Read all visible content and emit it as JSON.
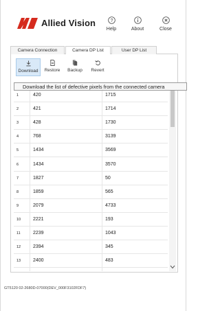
{
  "header": {
    "brand": "Allied Vision",
    "brand_color": "#d52b1e",
    "help_label": "Help",
    "about_label": "About",
    "close_label": "Close"
  },
  "tabs": [
    {
      "label": "Camera Connection"
    },
    {
      "label": "Camera DP List"
    },
    {
      "label": "User DP List"
    }
  ],
  "toolbar": {
    "download_label": "Download",
    "restore_label": "Restore",
    "backup_label": "Backup",
    "revert_label": "Revert"
  },
  "tooltip": "Download the list of defective pixels from the connected camera",
  "dp_table": {
    "rows": [
      {
        "idx": "1",
        "x": "420",
        "y": "1715"
      },
      {
        "idx": "2",
        "x": "421",
        "y": "1714"
      },
      {
        "idx": "3",
        "x": "428",
        "y": "1730"
      },
      {
        "idx": "4",
        "x": "768",
        "y": "3139"
      },
      {
        "idx": "5",
        "x": "1434",
        "y": "3569"
      },
      {
        "idx": "6",
        "x": "1434",
        "y": "3570"
      },
      {
        "idx": "7",
        "x": "1827",
        "y": "50"
      },
      {
        "idx": "8",
        "x": "1859",
        "y": "565"
      },
      {
        "idx": "9",
        "x": "2079",
        "y": "4733"
      },
      {
        "idx": "10",
        "x": "2221",
        "y": "193"
      },
      {
        "idx": "11",
        "x": "2239",
        "y": "1043"
      },
      {
        "idx": "12",
        "x": "2394",
        "y": "345"
      },
      {
        "idx": "13",
        "x": "2400",
        "y": "483"
      }
    ]
  },
  "status": {
    "device": "GT5120 02-2680D-07000(DEV_000F3102FDF7)"
  }
}
